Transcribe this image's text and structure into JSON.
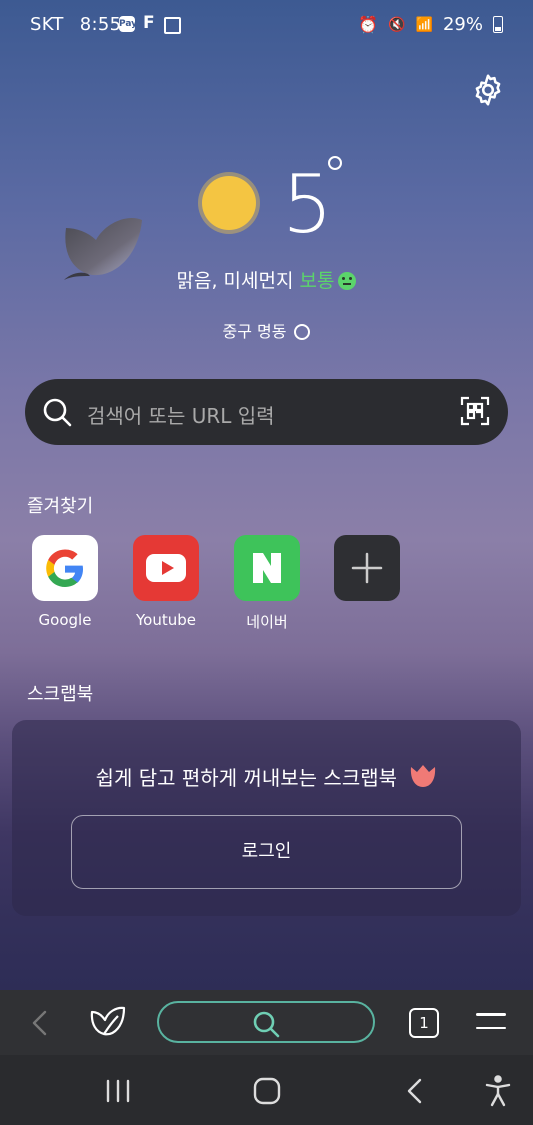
{
  "status": {
    "carrier": "SKT",
    "time": "8:55",
    "notif_icons": [
      "pay-icon",
      "f-icon",
      "gallery-icon"
    ],
    "right_icons": [
      "alarm-icon",
      "mute-icon",
      "wifi-icon",
      "signal-icon"
    ],
    "battery": "29%"
  },
  "weather": {
    "temperature": "5",
    "condition": "맑음, 미세먼지",
    "air_quality": "보통",
    "location": "중구 명동"
  },
  "search": {
    "placeholder": "검색어 또는 URL 입력"
  },
  "favorites": {
    "title": "즐겨찾기",
    "items": [
      {
        "label": "Google",
        "icon": "google-icon"
      },
      {
        "label": "Youtube",
        "icon": "youtube-icon"
      },
      {
        "label": "네이버",
        "icon": "naver-icon"
      },
      {
        "label": "",
        "icon": "plus-icon"
      }
    ]
  },
  "scrapbook": {
    "title": "스크랩북",
    "message": "쉽게 담고 편하게 꺼내보는 스크랩북",
    "login_label": "로그인"
  },
  "toolbar": {
    "tab_count": "1"
  },
  "colors": {
    "accent_green": "#5bd46b",
    "search_ring": "#59b3a0",
    "youtube_red": "#e53935",
    "naver_green": "#3ec35a"
  }
}
